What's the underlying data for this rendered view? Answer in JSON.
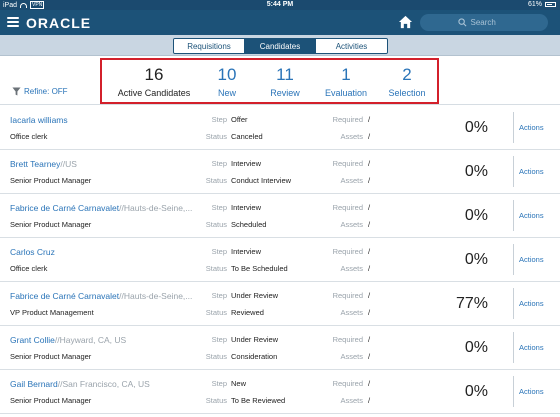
{
  "status_bar": {
    "carrier": "iPad",
    "network": "VPN",
    "time": "5:44 PM",
    "battery": "61%"
  },
  "app": {
    "logo": "ORACLE",
    "search_placeholder": "Search"
  },
  "tabs": [
    {
      "label": "Requisitions",
      "active": false
    },
    {
      "label": "Candidates",
      "active": true
    },
    {
      "label": "Activities",
      "active": false
    }
  ],
  "refine": {
    "label": "Refine: OFF"
  },
  "stats": [
    {
      "value": "16",
      "label": "Active Candidates"
    },
    {
      "value": "10",
      "label": "New"
    },
    {
      "value": "11",
      "label": "Review"
    },
    {
      "value": "1",
      "label": "Evaluation"
    },
    {
      "value": "2",
      "label": "Selection"
    }
  ],
  "labels": {
    "step": "Step",
    "status": "Status",
    "required": "Required",
    "assets": "Assets",
    "actions": "Actions",
    "slash": "/"
  },
  "candidates": [
    {
      "name": "Iacarla williams",
      "location": "",
      "job": "Office clerk",
      "step": "Offer",
      "status": "Canceled",
      "percent": "0%"
    },
    {
      "name": "Brett Tearney",
      "location": "//US",
      "job": "Senior Product Manager",
      "step": "Interview",
      "status": "Conduct Interview",
      "percent": "0%"
    },
    {
      "name": "Fabrice de Carné  Carnavalet",
      "location": "//Hauts-de-Seine,...",
      "job": "Senior Product Manager",
      "step": "Interview",
      "status": "Scheduled",
      "percent": "0%"
    },
    {
      "name": "Carlos Cruz",
      "location": "",
      "job": "Office clerk",
      "step": "Interview",
      "status": "To Be Scheduled",
      "percent": "0%"
    },
    {
      "name": "Fabrice de Carné  Carnavalet",
      "location": "//Hauts-de-Seine,...",
      "job": "VP Product Management",
      "step": "Under Review",
      "status": "Reviewed",
      "percent": "77%"
    },
    {
      "name": "Grant Collie",
      "location": "//Hayward, CA, US",
      "job": "Senior Product Manager",
      "step": "Under Review",
      "status": "Consideration",
      "percent": "0%"
    },
    {
      "name": "Gail Bernard",
      "location": "//San Francisco, CA, US",
      "job": "Senior Product Manager",
      "step": "New",
      "status": "To Be Reviewed",
      "percent": "0%"
    }
  ]
}
